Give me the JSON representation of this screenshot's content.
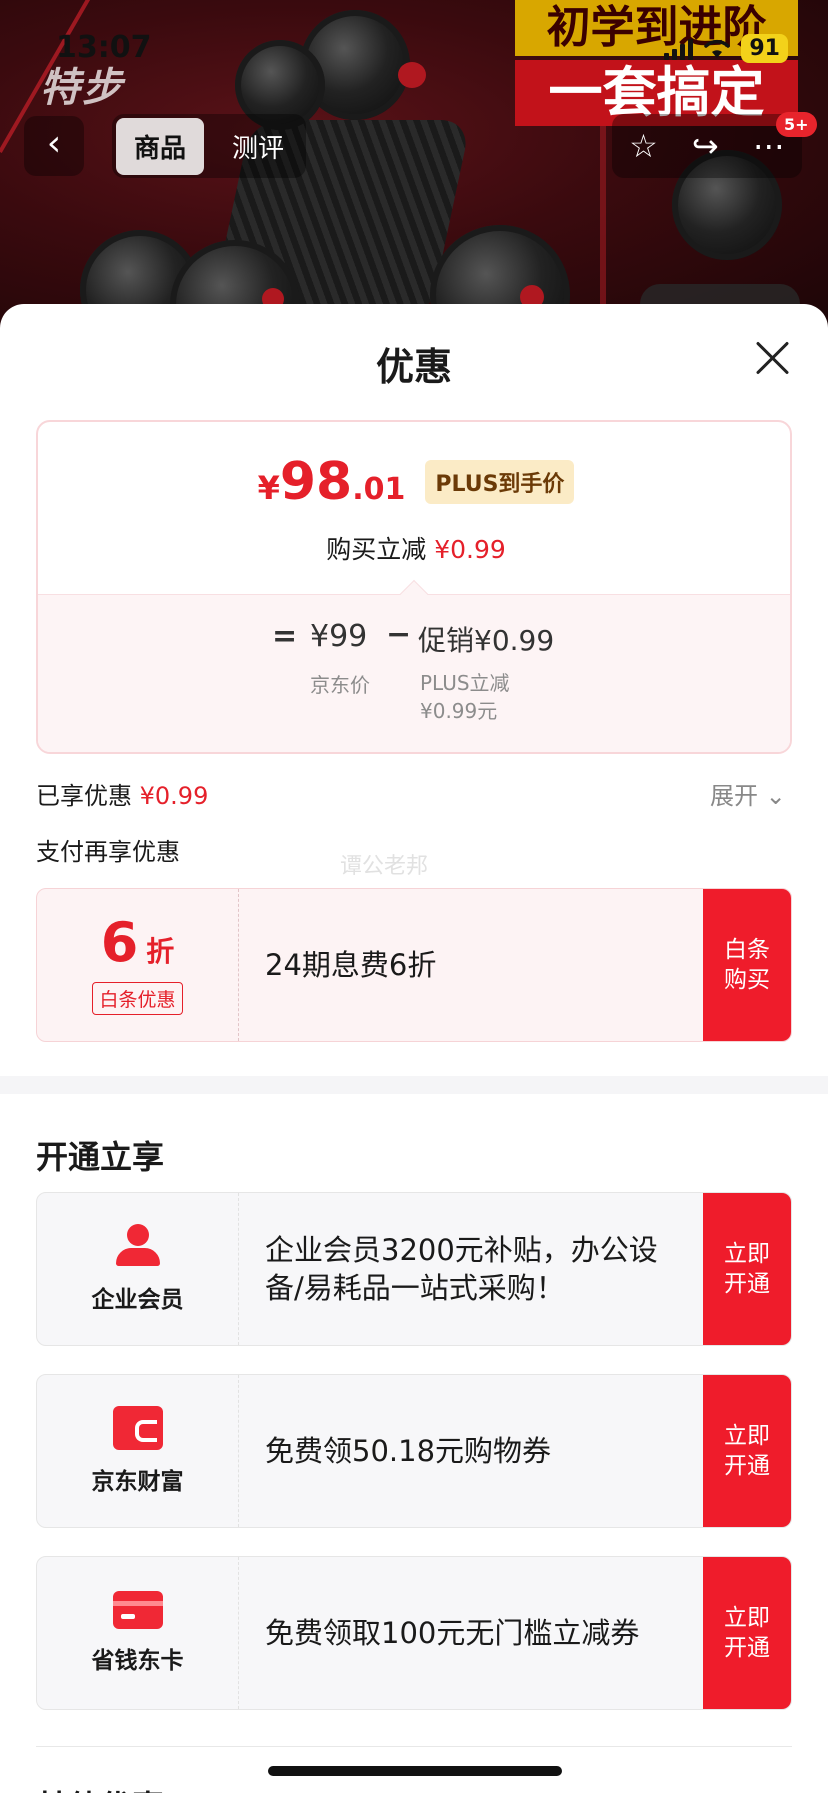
{
  "status": {
    "time": "13:07",
    "battery": "91"
  },
  "hero": {
    "brand": "特步",
    "promo_line1": "初学到进阶",
    "promo_line2": "一套搞定",
    "badge": "5+"
  },
  "nav": {
    "back_icon": "chevron-left-icon",
    "tabs": [
      {
        "label": "商品",
        "active": true
      },
      {
        "label": "测评",
        "active": false
      }
    ],
    "actions": [
      "star-icon",
      "share-icon",
      "more-icon"
    ]
  },
  "sheet": {
    "title": "优惠",
    "price": {
      "yen": "¥",
      "integer": "98",
      "decimal": ".01",
      "tag": "PLUS到手价",
      "sub_prefix": "购买立减",
      "sub_value": "¥0.99",
      "calc_eq": "=",
      "calc_price": "¥99",
      "calc_minus": "−",
      "calc_promo": "促销¥0.99",
      "label_price": "京东价",
      "label_promo_line1": "PLUS立减",
      "label_promo_line2": "¥0.99元"
    },
    "enjoyed_prefix": "已享优惠",
    "enjoyed_value": "¥0.99",
    "expand": "展开",
    "pay_title": "支付再享优惠",
    "pay_offer": {
      "discount_num": "6",
      "discount_unit": "折",
      "tag": "白条优惠",
      "text": "24期息费6折",
      "button": "白条购买"
    },
    "open_title": "开通立享",
    "open_offers": [
      {
        "icon": "person-icon",
        "label": "企业会员",
        "text": "企业会员3200元补贴，办公设备/易耗品一站式采购！",
        "button": "立即开通"
      },
      {
        "icon": "wallet-icon",
        "label": "京东财富",
        "text": "免费领50.18元购物券",
        "button": "立即开通"
      },
      {
        "icon": "card-icon",
        "label": "省钱东卡",
        "text": "免费领取100元无门槛立减券",
        "button": "立即开通"
      }
    ],
    "other_title": "其他优惠",
    "watermark": "谭公老邦"
  },
  "colors": {
    "accent": "#ef1c2b",
    "price_red": "#e5202a",
    "plus_bg": "#fbebc6"
  }
}
